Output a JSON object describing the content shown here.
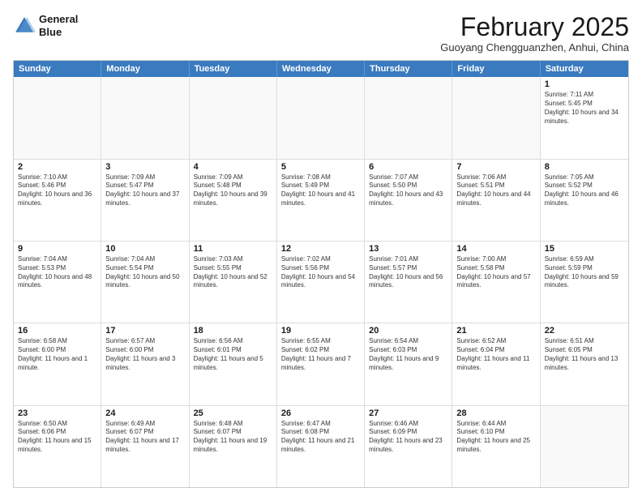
{
  "logo": {
    "line1": "General",
    "line2": "Blue"
  },
  "title": "February 2025",
  "location": "Guoyang Chengguanzhen, Anhui, China",
  "weekdays": [
    "Sunday",
    "Monday",
    "Tuesday",
    "Wednesday",
    "Thursday",
    "Friday",
    "Saturday"
  ],
  "weeks": [
    [
      {
        "day": "",
        "text": ""
      },
      {
        "day": "",
        "text": ""
      },
      {
        "day": "",
        "text": ""
      },
      {
        "day": "",
        "text": ""
      },
      {
        "day": "",
        "text": ""
      },
      {
        "day": "",
        "text": ""
      },
      {
        "day": "1",
        "text": "Sunrise: 7:11 AM\nSunset: 5:45 PM\nDaylight: 10 hours and 34 minutes."
      }
    ],
    [
      {
        "day": "2",
        "text": "Sunrise: 7:10 AM\nSunset: 5:46 PM\nDaylight: 10 hours and 36 minutes."
      },
      {
        "day": "3",
        "text": "Sunrise: 7:09 AM\nSunset: 5:47 PM\nDaylight: 10 hours and 37 minutes."
      },
      {
        "day": "4",
        "text": "Sunrise: 7:09 AM\nSunset: 5:48 PM\nDaylight: 10 hours and 39 minutes."
      },
      {
        "day": "5",
        "text": "Sunrise: 7:08 AM\nSunset: 5:49 PM\nDaylight: 10 hours and 41 minutes."
      },
      {
        "day": "6",
        "text": "Sunrise: 7:07 AM\nSunset: 5:50 PM\nDaylight: 10 hours and 43 minutes."
      },
      {
        "day": "7",
        "text": "Sunrise: 7:06 AM\nSunset: 5:51 PM\nDaylight: 10 hours and 44 minutes."
      },
      {
        "day": "8",
        "text": "Sunrise: 7:05 AM\nSunset: 5:52 PM\nDaylight: 10 hours and 46 minutes."
      }
    ],
    [
      {
        "day": "9",
        "text": "Sunrise: 7:04 AM\nSunset: 5:53 PM\nDaylight: 10 hours and 48 minutes."
      },
      {
        "day": "10",
        "text": "Sunrise: 7:04 AM\nSunset: 5:54 PM\nDaylight: 10 hours and 50 minutes."
      },
      {
        "day": "11",
        "text": "Sunrise: 7:03 AM\nSunset: 5:55 PM\nDaylight: 10 hours and 52 minutes."
      },
      {
        "day": "12",
        "text": "Sunrise: 7:02 AM\nSunset: 5:56 PM\nDaylight: 10 hours and 54 minutes."
      },
      {
        "day": "13",
        "text": "Sunrise: 7:01 AM\nSunset: 5:57 PM\nDaylight: 10 hours and 56 minutes."
      },
      {
        "day": "14",
        "text": "Sunrise: 7:00 AM\nSunset: 5:58 PM\nDaylight: 10 hours and 57 minutes."
      },
      {
        "day": "15",
        "text": "Sunrise: 6:59 AM\nSunset: 5:59 PM\nDaylight: 10 hours and 59 minutes."
      }
    ],
    [
      {
        "day": "16",
        "text": "Sunrise: 6:58 AM\nSunset: 6:00 PM\nDaylight: 11 hours and 1 minute."
      },
      {
        "day": "17",
        "text": "Sunrise: 6:57 AM\nSunset: 6:00 PM\nDaylight: 11 hours and 3 minutes."
      },
      {
        "day": "18",
        "text": "Sunrise: 6:56 AM\nSunset: 6:01 PM\nDaylight: 11 hours and 5 minutes."
      },
      {
        "day": "19",
        "text": "Sunrise: 6:55 AM\nSunset: 6:02 PM\nDaylight: 11 hours and 7 minutes."
      },
      {
        "day": "20",
        "text": "Sunrise: 6:54 AM\nSunset: 6:03 PM\nDaylight: 11 hours and 9 minutes."
      },
      {
        "day": "21",
        "text": "Sunrise: 6:52 AM\nSunset: 6:04 PM\nDaylight: 11 hours and 11 minutes."
      },
      {
        "day": "22",
        "text": "Sunrise: 6:51 AM\nSunset: 6:05 PM\nDaylight: 11 hours and 13 minutes."
      }
    ],
    [
      {
        "day": "23",
        "text": "Sunrise: 6:50 AM\nSunset: 6:06 PM\nDaylight: 11 hours and 15 minutes."
      },
      {
        "day": "24",
        "text": "Sunrise: 6:49 AM\nSunset: 6:07 PM\nDaylight: 11 hours and 17 minutes."
      },
      {
        "day": "25",
        "text": "Sunrise: 6:48 AM\nSunset: 6:07 PM\nDaylight: 11 hours and 19 minutes."
      },
      {
        "day": "26",
        "text": "Sunrise: 6:47 AM\nSunset: 6:08 PM\nDaylight: 11 hours and 21 minutes."
      },
      {
        "day": "27",
        "text": "Sunrise: 6:46 AM\nSunset: 6:09 PM\nDaylight: 11 hours and 23 minutes."
      },
      {
        "day": "28",
        "text": "Sunrise: 6:44 AM\nSunset: 6:10 PM\nDaylight: 11 hours and 25 minutes."
      },
      {
        "day": "",
        "text": ""
      }
    ]
  ]
}
